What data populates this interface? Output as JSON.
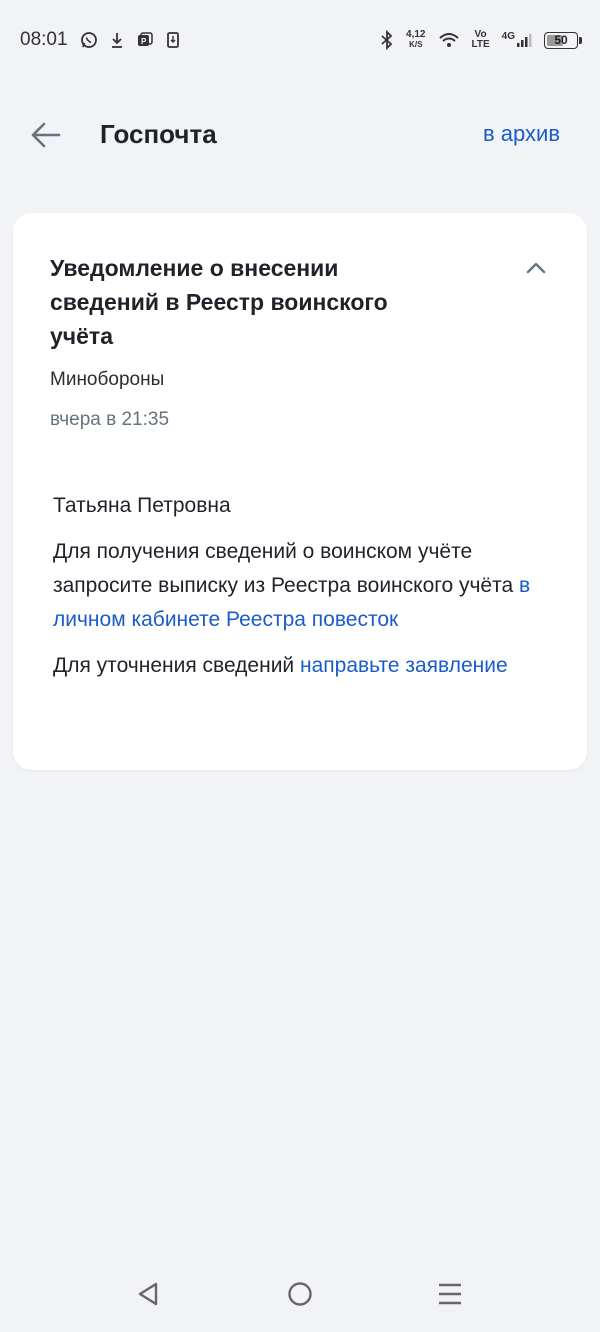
{
  "status_bar": {
    "time": "08:01",
    "net_speed_value": "4,12",
    "net_speed_unit": "K/S",
    "volte_top": "Vo",
    "volte_bottom": "LTE",
    "network": "4G",
    "battery": "50",
    "icons": [
      "whatsapp-icon",
      "download-icon",
      "notification-icon",
      "sim-icon",
      "bluetooth-icon",
      "wifi-icon",
      "signal-icon",
      "battery-icon"
    ]
  },
  "header": {
    "title": "Госпочта",
    "archive_label": "в архив",
    "back_icon": "arrow-left-icon"
  },
  "message": {
    "title": "Уведомление о внесении сведений в Реестр воинского учёта",
    "sender": "Минобороны",
    "date": "вчера в 21:35",
    "greeting": "Татьяна Петровна",
    "paragraph1_text": "Для получения сведений о воинском учёте запросите выписку из Реестра воинского учёта ",
    "paragraph1_link": "в личном кабинете Реестра повесток",
    "paragraph2_text": "Для уточнения сведений ",
    "paragraph2_link": "направьте заявление",
    "collapse_icon": "chevron-up-icon"
  },
  "nav_bar": {
    "icons": [
      "back-triangle-icon",
      "home-circle-icon",
      "menu-lines-icon"
    ]
  },
  "colors": {
    "background": "#f2f3f6",
    "card": "#ffffff",
    "link": "#1a5cc8",
    "text": "#1f2329",
    "muted": "#66727f"
  }
}
